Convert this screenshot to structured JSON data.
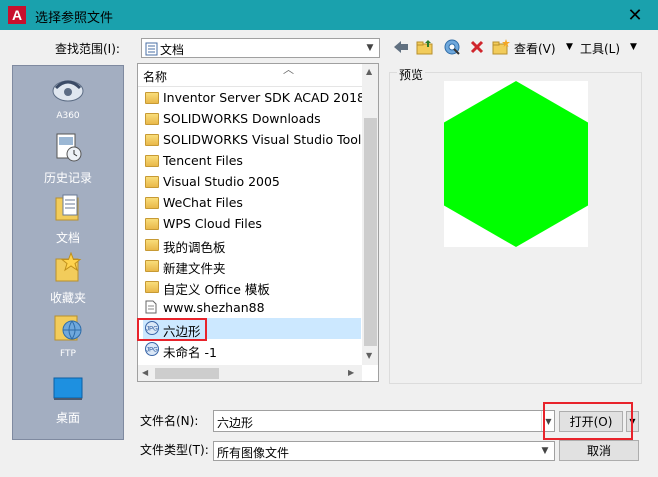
{
  "window": {
    "title": "选择参照文件",
    "close_glyph": "✕",
    "app_logo": "A"
  },
  "toolbar": {
    "lookin_label": "查找范围(I):",
    "lookin_value": "文档",
    "view_label": "查看(V)",
    "tools_label": "工具(L)",
    "dropdown_glyph": "▼",
    "icons": [
      "back-icon",
      "up-folder-icon",
      "search-web-icon",
      "delete-icon",
      "new-folder-icon"
    ]
  },
  "places": [
    {
      "label": "A360",
      "icon": "a360-icon"
    },
    {
      "label": "历史记录",
      "icon": "history-icon"
    },
    {
      "label": "文档",
      "icon": "documents-icon"
    },
    {
      "label": "收藏夹",
      "icon": "favorites-icon"
    },
    {
      "label": "FTP",
      "icon": "ftp-icon"
    },
    {
      "label": "桌面",
      "icon": "desktop-icon"
    }
  ],
  "filelist": {
    "column_header": "名称",
    "items": [
      {
        "name": "Inventor Server SDK ACAD 2018",
        "type": "folder"
      },
      {
        "name": "SOLIDWORKS Downloads",
        "type": "folder"
      },
      {
        "name": "SOLIDWORKS Visual Studio Tools",
        "type": "folder"
      },
      {
        "name": "Tencent Files",
        "type": "folder"
      },
      {
        "name": "Visual Studio 2005",
        "type": "folder"
      },
      {
        "name": "WeChat Files",
        "type": "folder"
      },
      {
        "name": "WPS Cloud Files",
        "type": "folder"
      },
      {
        "name": "我的调色板",
        "type": "folder"
      },
      {
        "name": "新建文件夹",
        "type": "folder"
      },
      {
        "name": "自定义 Office 模板",
        "type": "folder"
      },
      {
        "name": "www.shezhan88",
        "type": "file"
      },
      {
        "name": "六边形",
        "type": "jpg",
        "selected": true
      },
      {
        "name": "未命名 -1",
        "type": "jpg"
      }
    ]
  },
  "preview": {
    "label": "预览",
    "shape_color": "#00ff00"
  },
  "bottom": {
    "filename_label": "文件名(N):",
    "filename_value": "六边形",
    "filetype_label": "文件类型(T):",
    "filetype_value": "所有图像文件",
    "open_label": "打开(O)",
    "cancel_label": "取消"
  },
  "colors": {
    "titlebar": "#1aa1ad",
    "selection": "#cce8ff",
    "highlight": "#e8232b",
    "places_bg": "#a3aec1"
  }
}
